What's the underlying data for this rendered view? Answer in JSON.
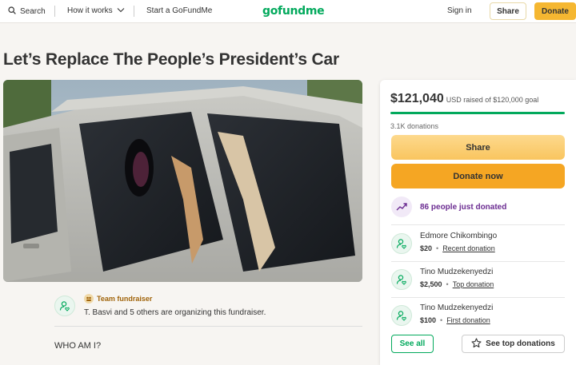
{
  "nav": {
    "search_label": "Search",
    "how_it_works_label": "How it works",
    "start_label": "Start a GoFundMe",
    "logo_text": "gofundme",
    "signin_label": "Sign in",
    "share_label": "Share",
    "donate_label": "Donate"
  },
  "campaign": {
    "title": "Let’s Replace The People’s President’s Car",
    "organizer_badge": "Team fundraiser",
    "organizer_text": "T. Basvi and 5 others are organizing this fundraiser.",
    "story_heading": "WHO AM I?"
  },
  "panel": {
    "raised_amount": "$121,040",
    "raised_goal_text": "USD raised of $120,000 goal",
    "progress_fraction": 1.0,
    "donation_count": "3.1K donations",
    "share_label": "Share",
    "donate_now_label": "Donate now",
    "recent_activity": "86 people just donated",
    "donations": [
      {
        "name": "Edmore Chikombingo",
        "amount": "$20",
        "tag": "Recent donation"
      },
      {
        "name": "Tino Mudzekenyedzi",
        "amount": "$2,500",
        "tag": "Top donation"
      },
      {
        "name": "Tino Mudzekenyedzi",
        "amount": "$100",
        "tag": "First donation"
      }
    ],
    "see_all_label": "See all",
    "see_top_label": "See top donations"
  },
  "colors": {
    "brand_green": "#02a95c",
    "donate_orange": "#f5a623",
    "activity_purple": "#6b2c91"
  },
  "icons": [
    "search-icon",
    "chevron-down-icon",
    "user-heart-icon",
    "trend-up-icon",
    "star-icon",
    "team-badge-icon"
  ]
}
